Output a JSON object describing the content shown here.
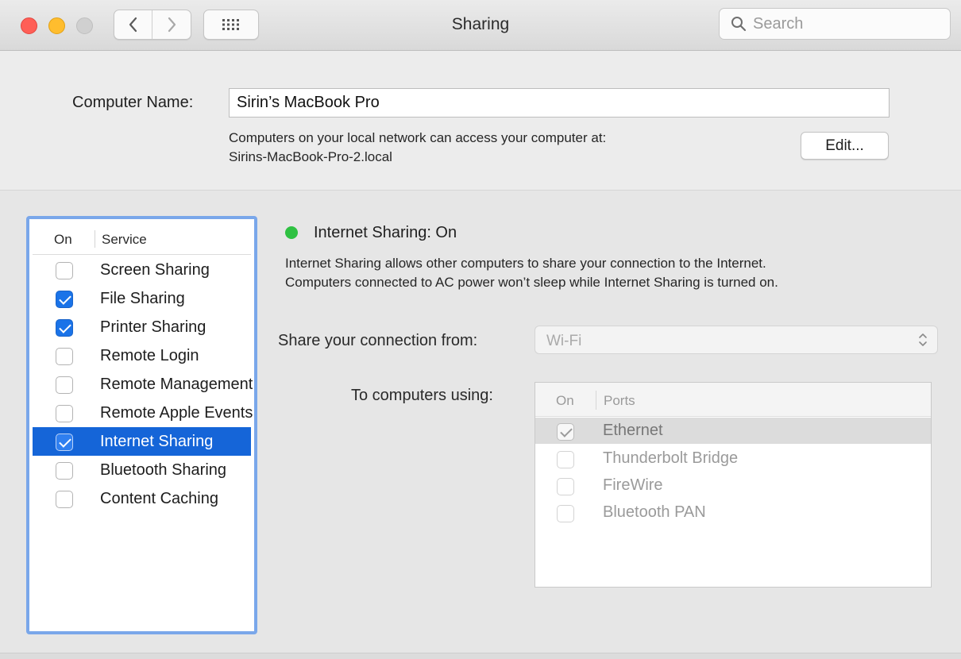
{
  "window": {
    "title": "Sharing"
  },
  "search": {
    "placeholder": "Search"
  },
  "computer_name": {
    "label": "Computer Name:",
    "value": "Sirin’s MacBook Pro",
    "info_line1": "Computers on your local network can access your computer at:",
    "info_line2": "Sirins-MacBook-Pro-2.local",
    "edit_label": "Edit..."
  },
  "services": {
    "header_on": "On",
    "header_service": "Service",
    "items": [
      {
        "label": "Screen Sharing",
        "checked": false
      },
      {
        "label": "File Sharing",
        "checked": true
      },
      {
        "label": "Printer Sharing",
        "checked": true
      },
      {
        "label": "Remote Login",
        "checked": false
      },
      {
        "label": "Remote Management",
        "checked": false
      },
      {
        "label": "Remote Apple Events",
        "checked": false
      },
      {
        "label": "Internet Sharing",
        "checked": true,
        "selected": true
      },
      {
        "label": "Bluetooth Sharing",
        "checked": false
      },
      {
        "label": "Content Caching",
        "checked": false
      }
    ]
  },
  "detail": {
    "status": "Internet Sharing: On",
    "status_color": "#2fc142",
    "desc_line1": "Internet Sharing allows other computers to share your connection to the Internet.",
    "desc_line2": "Computers connected to AC power won’t sleep while Internet Sharing is turned on.",
    "share_from_label": "Share your connection from:",
    "share_from_value": "Wi-Fi",
    "to_computers_label": "To computers using:",
    "ports_header_on": "On",
    "ports_header_ports": "Ports",
    "ports": [
      {
        "label": "Ethernet",
        "checked": true,
        "selected": true
      },
      {
        "label": "Thunderbolt Bridge",
        "checked": false
      },
      {
        "label": "FireWire",
        "checked": false
      },
      {
        "label": "Bluetooth PAN",
        "checked": false
      }
    ]
  },
  "colors": {
    "accent": "#1565d8",
    "focus_ring": "#7aa7ea",
    "close": "#ff5f57",
    "minimize": "#ffbd2e"
  }
}
